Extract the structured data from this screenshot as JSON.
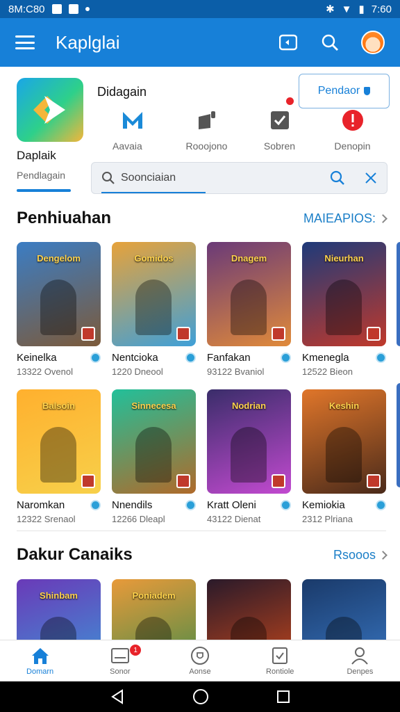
{
  "status_bar": {
    "time_left": "8M:C80",
    "time_right": "7:60"
  },
  "app_bar": {
    "title": "Kaplglai"
  },
  "featured": {
    "app_name": "Daplaik",
    "app_subtitle": "Pendlagain",
    "section_label": "Didagain",
    "action_button": "Pendaor",
    "categories": [
      {
        "label": "Aavaia",
        "icon": "m-logo-icon"
      },
      {
        "label": "Rooojono",
        "icon": "puzzle-icon"
      },
      {
        "label": "Sobren",
        "icon": "checkbox-icon"
      },
      {
        "label": "Denopin",
        "icon": "alert-icon"
      }
    ]
  },
  "search": {
    "placeholder": "Soonciaian"
  },
  "sections": [
    {
      "title": "Penhiuahan",
      "more_label": "MAIEAPIOS:",
      "games": [
        {
          "name": "Keinelka",
          "meta": "13322 Ovenol",
          "banner": "Dengelom",
          "colors": [
            "#3b7dc4",
            "#7c5a3a"
          ]
        },
        {
          "name": "Nentcioka",
          "meta": "1220 Dneool",
          "banner": "Gomidos",
          "colors": [
            "#e7a23a",
            "#3fa0d8"
          ]
        },
        {
          "name": "Fanfakan",
          "meta": "93122 Bvaniol",
          "banner": "Dnagem",
          "colors": [
            "#6a3a78",
            "#e08a3a"
          ]
        },
        {
          "name": "Kmenegla",
          "meta": "12522 Bieon",
          "banner": "Nieurhan",
          "colors": [
            "#1e3a7a",
            "#c0392b"
          ]
        },
        {
          "name": "Naromkan",
          "meta": "12322 Srenaol",
          "banner": "Balsoin",
          "colors": [
            "#ffb02e",
            "#f7d04a"
          ]
        },
        {
          "name": "Nnendils",
          "meta": "12266 Dleapl",
          "banner": "Sinnecesa",
          "colors": [
            "#22c09a",
            "#b06a2a"
          ]
        },
        {
          "name": "Kratt Oleni",
          "meta": "43122 Dienat",
          "banner": "Nodrian",
          "colors": [
            "#3a2d6a",
            "#c24ad0"
          ]
        },
        {
          "name": "Kemiokia",
          "meta": "2312 Plriana",
          "banner": "Keshin",
          "colors": [
            "#e0762a",
            "#4a2a1a"
          ]
        }
      ]
    },
    {
      "title": "Dakur Canaiks",
      "more_label": "Rsooos",
      "games": [
        {
          "name": "",
          "meta": "",
          "banner": "Shinbam",
          "colors": [
            "#6a3ab8",
            "#3a9ad8"
          ]
        },
        {
          "name": "",
          "meta": "",
          "banner": "Poniadem",
          "colors": [
            "#e89a3a",
            "#3a8a4a"
          ]
        },
        {
          "name": "",
          "meta": "",
          "banner": "",
          "colors": [
            "#2a1a2a",
            "#d04a1a"
          ]
        },
        {
          "name": "",
          "meta": "",
          "banner": "",
          "colors": [
            "#1a3a6a",
            "#3a7ac8"
          ]
        }
      ]
    }
  ],
  "bottom_nav": {
    "items": [
      {
        "label": "Domarn",
        "icon": "home-icon",
        "active": true
      },
      {
        "label": "Sonor",
        "icon": "inbox-icon",
        "badge": "1"
      },
      {
        "label": "Aonse",
        "icon": "shield-icon"
      },
      {
        "label": "Rontiole",
        "icon": "document-icon"
      },
      {
        "label": "Denpes",
        "icon": "person-icon"
      }
    ]
  },
  "colors": {
    "primary": "#1780d8",
    "status_bar": "#0b5ea8",
    "alert": "#e8232a"
  }
}
